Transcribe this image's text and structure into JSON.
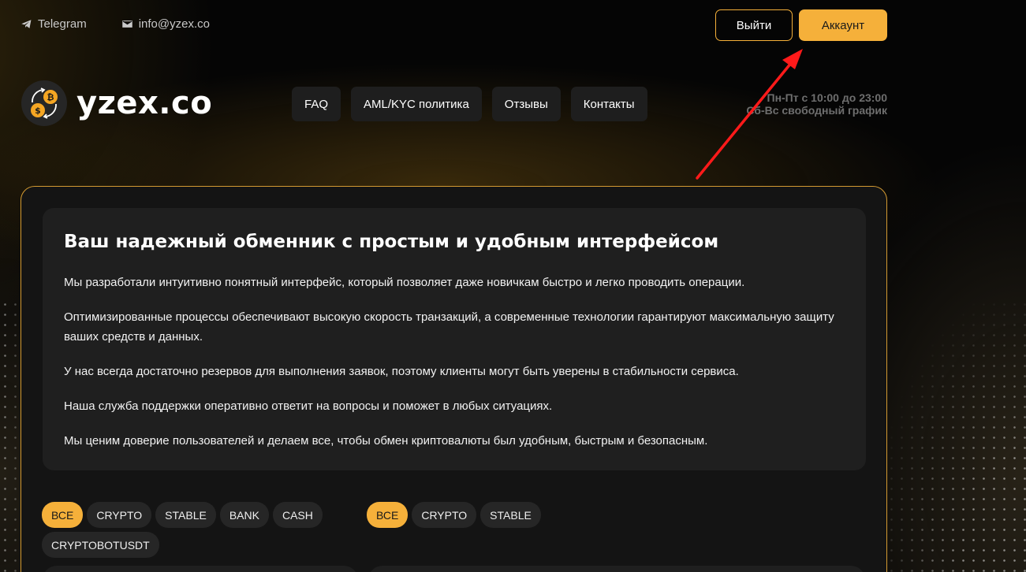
{
  "topbar": {
    "telegram": "Telegram",
    "email": "info@yzex.co"
  },
  "auth": {
    "logout": "Выйти",
    "account": "Аккаунт"
  },
  "brand": {
    "name": "yzex.co"
  },
  "nav": [
    {
      "label": "FAQ"
    },
    {
      "label": "AML/KYC политика"
    },
    {
      "label": "Отзывы"
    },
    {
      "label": "Контакты"
    }
  ],
  "hours": {
    "weekdays": "Пн-Пт с 10:00 до 23:00",
    "weekend": "Сб-Вс свободный график"
  },
  "intro": {
    "title": "Ваш надежный обменник с простым и удобным интерфейсом",
    "paragraphs": [
      "Мы разработали интуитивно понятный интерфейс, который позволяет даже новичкам быстро и легко проводить операции.",
      "Оптимизированные процессы обеспечивают высокую скорость транзакций, а современные технологии гарантируют максимальную защиту ваших средств и данных.",
      "У нас всегда достаточно резервов для выполнения заявок, поэтому клиенты могут быть уверены в стабильности сервиса.",
      "Наша служба поддержки оперативно ответит на вопросы и поможет в любых ситуациях.",
      "Мы ценим доверие пользователей и делаем все, чтобы обмен криптовалюты был удобным, быстрым и безопасным."
    ]
  },
  "filters_give": [
    "ВСЕ",
    "CRYPTO",
    "STABLE",
    "BANK",
    "CASH",
    "CRYPTOBOTUSDT"
  ],
  "filters_get": [
    "ВСЕ",
    "CRYPTO",
    "STABLE"
  ],
  "colors": {
    "accent": "#f5b03a",
    "annotation_arrow": "#ff1a1a"
  },
  "icons": {
    "telegram": "telegram-icon",
    "email": "mail-icon",
    "logo": "exchange-coins-icon"
  }
}
